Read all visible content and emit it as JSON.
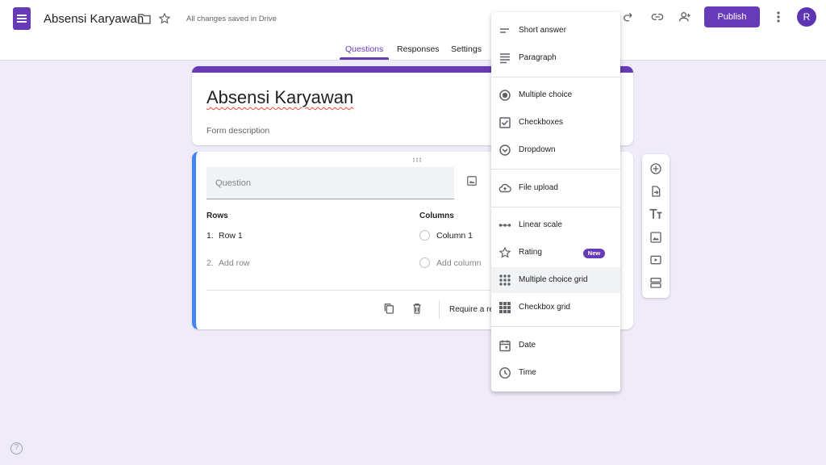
{
  "header": {
    "form_title": "Absensi Karyawan",
    "save_status": "All changes saved in Drive",
    "publish_label": "Publish",
    "avatar_initial": "R"
  },
  "tabs": [
    {
      "label": "Questions",
      "active": true
    },
    {
      "label": "Responses",
      "active": false
    },
    {
      "label": "Settings",
      "active": false
    }
  ],
  "title_card": {
    "title": "Absensi Karyawan",
    "description_placeholder": "Form description"
  },
  "question_card": {
    "question_placeholder": "Question",
    "rows_label": "Rows",
    "columns_label": "Columns",
    "rows": [
      {
        "index": "1.",
        "text": "Row 1"
      },
      {
        "index": "2.",
        "text": "Add row"
      }
    ],
    "columns": [
      "Column 1",
      "Add column"
    ],
    "require_label": "Require a re"
  },
  "question_type_menu": {
    "items": [
      {
        "label": "Short answer",
        "icon": "short-answer-icon"
      },
      {
        "label": "Paragraph",
        "icon": "paragraph-icon"
      },
      {
        "label": "Multiple choice",
        "icon": "radio-icon"
      },
      {
        "label": "Checkboxes",
        "icon": "checkbox-icon"
      },
      {
        "label": "Dropdown",
        "icon": "dropdown-icon"
      },
      {
        "label": "File upload",
        "icon": "cloud-upload-icon"
      },
      {
        "label": "Linear scale",
        "icon": "linear-scale-icon"
      },
      {
        "label": "Rating",
        "icon": "star-icon",
        "badge": "New"
      },
      {
        "label": "Multiple choice grid",
        "icon": "grid-icon",
        "highlighted": true
      },
      {
        "label": "Checkbox grid",
        "icon": "checkbox-grid-icon"
      },
      {
        "label": "Date",
        "icon": "calendar-icon"
      },
      {
        "label": "Time",
        "icon": "clock-icon"
      }
    ]
  },
  "colors": {
    "accent": "#673ab7",
    "background": "#f0ebf8",
    "active_card_border": "#4285f4"
  },
  "help": "?"
}
